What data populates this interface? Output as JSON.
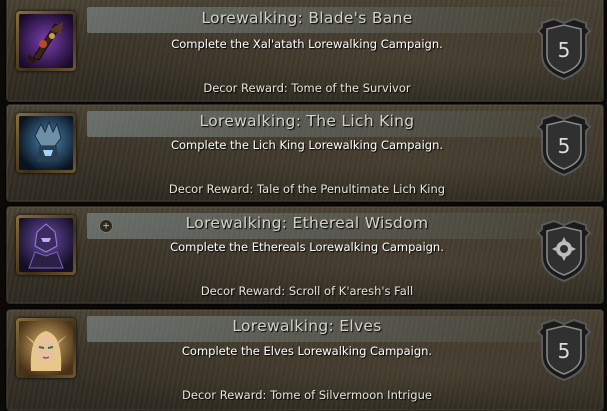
{
  "achievements": [
    {
      "title": "Lorewalking: Blade's Bane",
      "description": "Complete the Xal'atath Lorewalking Campaign.",
      "reward": "Decor Reward: Tome of the Survivor",
      "points": "5",
      "icon": "shadow-blade-icon",
      "completed": true
    },
    {
      "title": "Lorewalking: The Lich King",
      "description": "Complete the Lich King Lorewalking Campaign.",
      "reward": "Decor Reward: Tale of the Penultimate Lich King",
      "points": "5",
      "icon": "lich-king-icon",
      "completed": true
    },
    {
      "title": "Lorewalking: Ethereal Wisdom",
      "description": "Complete the Ethereals Lorewalking Campaign.",
      "reward": "Decor Reward: Scroll of K'aresh's Fall",
      "points": "",
      "icon": "ethereal-icon",
      "completed": true,
      "has_expand": true,
      "expand_glyph": "+"
    },
    {
      "title": "Lorewalking: Elves",
      "description": "Complete the Elves Lorewalking Campaign.",
      "reward": "Decor Reward: Tome of Silvermoon Intrigue",
      "points": "5",
      "icon": "blood-elf-icon",
      "completed": true
    }
  ],
  "colors": {
    "title": "#d6d2c8",
    "description": "#ffffff",
    "card_bg": "#3b3529",
    "shield": "#2c2c2c"
  }
}
